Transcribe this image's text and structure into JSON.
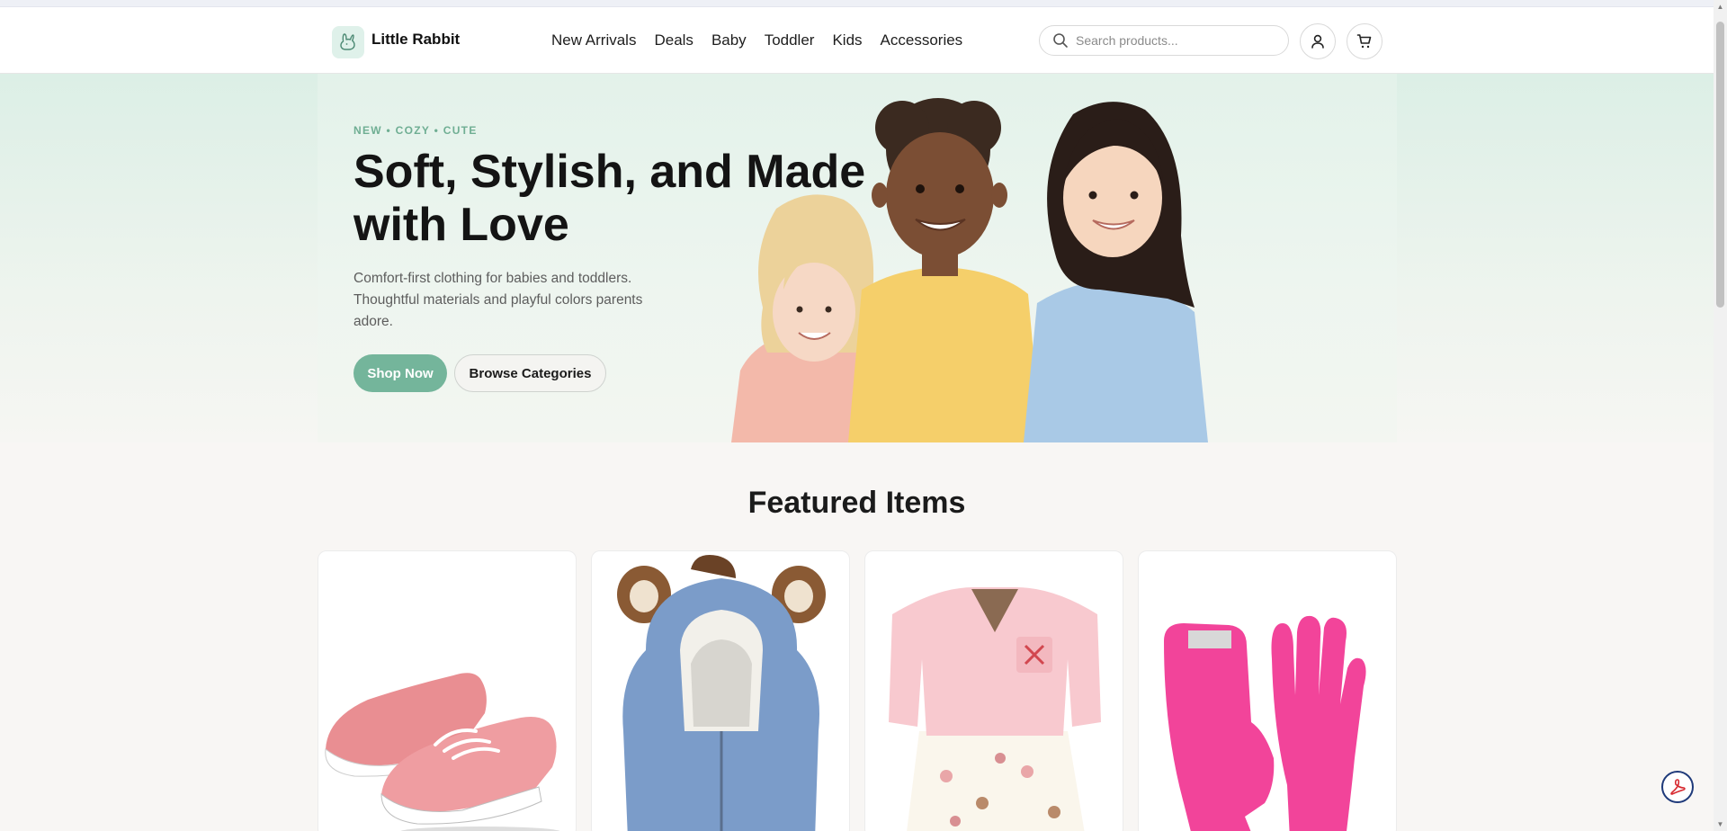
{
  "brand": {
    "name": "Little Rabbit",
    "logo_icon": "rabbit-icon"
  },
  "nav": {
    "items": [
      {
        "label": "New Arrivals"
      },
      {
        "label": "Deals"
      },
      {
        "label": "Baby"
      },
      {
        "label": "Toddler"
      },
      {
        "label": "Kids"
      },
      {
        "label": "Accessories"
      }
    ]
  },
  "search": {
    "placeholder": "Search products...",
    "value": "",
    "icon": "search-icon"
  },
  "header_actions": {
    "account_icon": "user-icon",
    "cart_icon": "cart-icon"
  },
  "hero": {
    "eyebrow": "NEW • COZY • CUTE",
    "title": "Soft, Stylish, and Made with Love",
    "subtitle": "Comfort-first clothing for babies and toddlers. Thoughtful materials and playful colors parents adore.",
    "primary_cta": "Shop Now",
    "secondary_cta": "Browse Categories"
  },
  "featured": {
    "heading": "Featured Items",
    "items": [
      {
        "image": "pink-sneakers"
      },
      {
        "image": "blue-fleece-hooded-vest"
      },
      {
        "image": "pink-cardigan-dress-set"
      },
      {
        "image": "pink-knit-gloves"
      }
    ]
  },
  "colors": {
    "accent": "#74b59b",
    "hero_bg": "#e3f2ea",
    "page_bg": "#f8f6f4"
  },
  "floating": {
    "icon": "adobe-pdf-icon"
  }
}
